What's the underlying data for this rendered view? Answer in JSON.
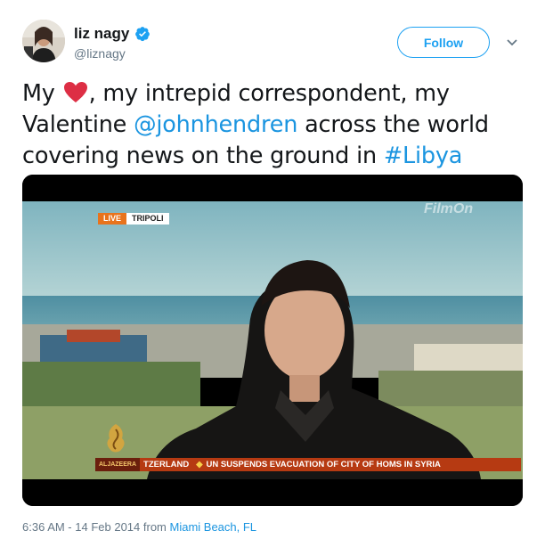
{
  "user": {
    "display_name": "liz nagy",
    "handle": "@liznagy",
    "verified": true,
    "follow_label": "Follow"
  },
  "tweet": {
    "text_part1": "My ",
    "text_part2": ", my intrepid correspondent, my Valentine ",
    "mention": "@johnhendren",
    "text_part3": " across the world covering news on the ground in ",
    "hashtag": "#Libya"
  },
  "media": {
    "live_label": "LIVE",
    "location": "TRIPOLI",
    "watermark": "FilmOn",
    "ticker_brand": "ALJAZEERA",
    "ticker_left": "TZERLAND",
    "ticker_headline": "UN SUSPENDS EVACUATION OF CITY OF HOMS IN SYRIA"
  },
  "footer": {
    "timestamp": "6:36 AM - 14 Feb 2014",
    "from_label": " from ",
    "place": "Miami Beach, FL"
  },
  "colors": {
    "link": "#1b95e0",
    "follow": "#1da1f2",
    "heart": "#e0245e",
    "meta": "#657786"
  },
  "icons": [
    "verified-badge-icon",
    "chevron-down-icon",
    "heart-emoji-icon",
    "aljazeera-logo-icon"
  ]
}
